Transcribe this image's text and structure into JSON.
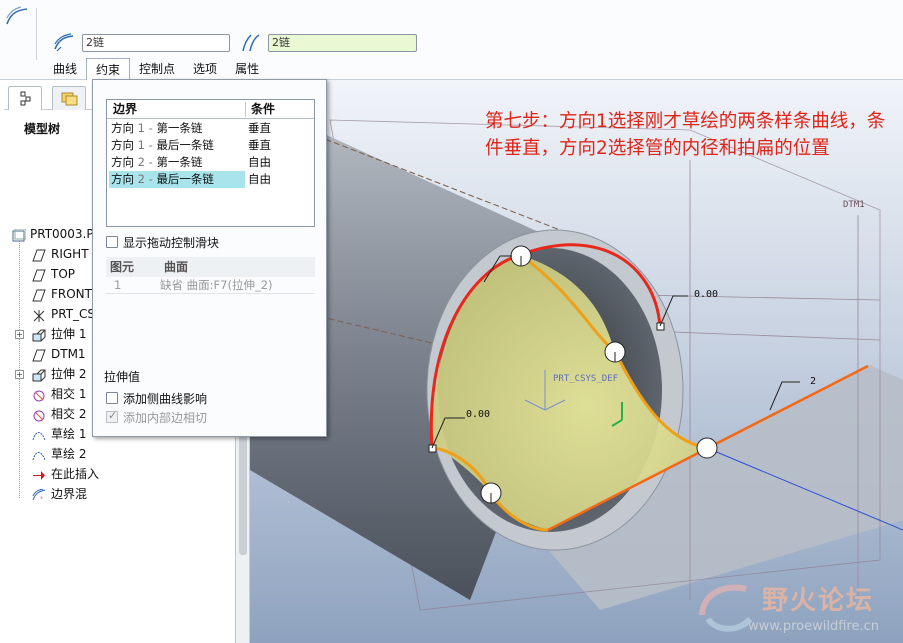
{
  "dashboard": {
    "chain_field_1": "2链",
    "chain_field_2": "2链",
    "tabs": [
      "曲线",
      "约束",
      "控制点",
      "选项",
      "属性"
    ],
    "active_tab": "约束",
    "field2_bg": "#eaf8d4"
  },
  "model_tree": {
    "title": "模型树",
    "items": [
      {
        "label": "PRT0003.P",
        "icon": "part-icon"
      },
      {
        "label": "RIGHT",
        "icon": "datum-plane-icon"
      },
      {
        "label": "TOP",
        "icon": "datum-plane-icon"
      },
      {
        "label": "FRONT",
        "icon": "datum-plane-icon"
      },
      {
        "label": "PRT_CS",
        "icon": "coordinate-system-icon"
      },
      {
        "label": "拉伸 1",
        "icon": "extrude-icon"
      },
      {
        "label": "DTM1",
        "icon": "datum-plane-icon"
      },
      {
        "label": "拉伸 2",
        "icon": "extrude-icon"
      },
      {
        "label": "相交 1",
        "icon": "intersect-icon"
      },
      {
        "label": "相交 2",
        "icon": "intersect-icon"
      },
      {
        "label": "草绘 1",
        "icon": "sketch-icon"
      },
      {
        "label": "草绘 2",
        "icon": "sketch-icon"
      },
      {
        "label": "在此插入",
        "icon": "insert-here-arrow-icon"
      },
      {
        "label": "边界混",
        "icon": "boundary-blend-icon"
      }
    ]
  },
  "constraint_panel": {
    "boundary_header": "边界",
    "condition_header": "条件",
    "rows": [
      {
        "dir": "方向",
        "num": " 1 - ",
        "name": "第一条链",
        "condition": "垂直",
        "selected": false
      },
      {
        "dir": "方向",
        "num": " 1 - ",
        "name": "最后一条链",
        "condition": "垂直",
        "selected": false
      },
      {
        "dir": "方向",
        "num": " 2 - ",
        "name": "第一条链",
        "condition": "自由",
        "selected": false
      },
      {
        "dir": "方向",
        "num": " 2 - ",
        "name": "最后一条链",
        "condition": "自由",
        "selected": true
      }
    ],
    "show_drag_slider": "显示拖动控制滑块",
    "element_header": "图元",
    "surface_header": "曲面",
    "element_row": {
      "index": "1",
      "surface": "缺省  曲面:F7(拉伸_2)"
    },
    "stretch_value": "拉伸值",
    "add_side_curve": "添加侧曲线影响",
    "add_inner_tangent": "添加内部边相切"
  },
  "viewport": {
    "note": "第七步：方向1选择刚才草绘的两条样条曲线，条件垂直，方向2选择管的内径和拍扁的位置",
    "labels": {
      "dtm1": "DTM1",
      "dim_top": "0.00",
      "dim_left": "0.00",
      "dim_two": "2",
      "csys": "PRT_CSYS_DEF"
    },
    "watermark_title": "野火论坛",
    "watermark_url": "www.proewildfire.cn",
    "colors": {
      "curve_red": "#e8281c",
      "curve_orange": "#f0a018",
      "surface": "#dcdc8a",
      "background_top": "#eef2f8",
      "background_bottom": "#8fa3bf"
    }
  }
}
